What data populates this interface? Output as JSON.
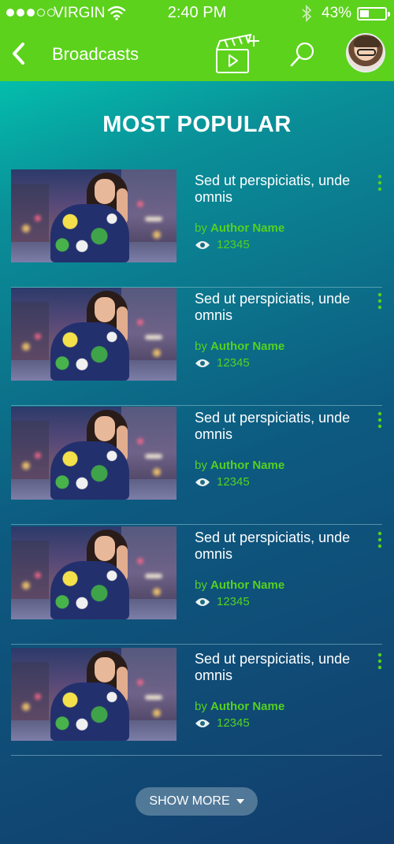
{
  "status_bar": {
    "carrier": "VIRGIN",
    "time": "2:40 PM",
    "battery": "43%",
    "battery_level": 0.43
  },
  "nav": {
    "title": "Broadcasts",
    "icons": [
      "back-icon",
      "new-broadcast-icon",
      "search-icon",
      "avatar"
    ]
  },
  "section_title": "MOST POPULAR",
  "items": [
    {
      "title": "Sed ut perspiciatis, unde omnis",
      "by": "by ",
      "author": "Author Name",
      "views": "12345"
    },
    {
      "title": "Sed ut perspiciatis, unde omnis",
      "by": "by ",
      "author": "Author Name",
      "views": "12345"
    },
    {
      "title": "Sed ut perspiciatis, unde omnis",
      "by": "by ",
      "author": "Author Name",
      "views": "12345"
    },
    {
      "title": "Sed ut perspiciatis, unde omnis",
      "by": "by ",
      "author": "Author Name",
      "views": "12345"
    },
    {
      "title": "Sed ut perspiciatis, unde omnis",
      "by": "by ",
      "author": "Author Name",
      "views": "12345"
    }
  ],
  "show_more_label": "SHOW MORE",
  "colors": {
    "accent_green": "#5cd21c",
    "text_green": "#55d11f",
    "gradient_top": "#00d9b8",
    "gradient_bottom": "#123d6c"
  }
}
